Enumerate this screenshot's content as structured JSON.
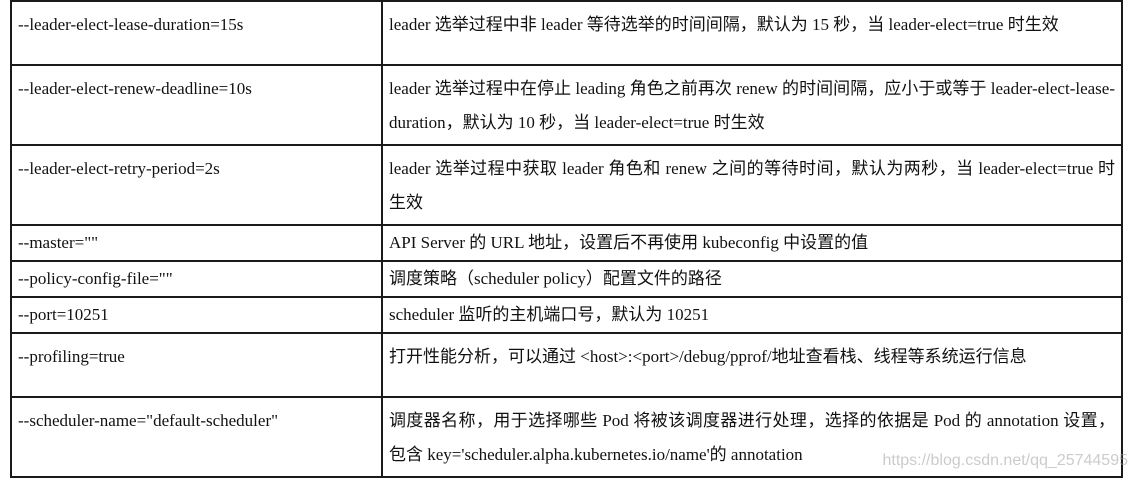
{
  "rows": [
    {
      "param": "--leader-elect-lease-duration=15s",
      "desc": "leader 选举过程中非 leader 等待选举的时间间隔，默认为 15 秒，当 leader-elect=true 时生效"
    },
    {
      "param": "--leader-elect-renew-deadline=10s",
      "desc": "leader 选举过程中在停止 leading 角色之前再次 renew 的时间间隔，应小于或等于 leader-elect-lease-duration，默认为 10 秒，当 leader-elect=true 时生效"
    },
    {
      "param": "--leader-elect-retry-period=2s",
      "desc": "leader 选举过程中获取 leader 角色和 renew 之间的等待时间，默认为两秒，当 leader-elect=true 时生效"
    },
    {
      "param": "--master=\"\"",
      "desc": "API Server 的 URL 地址，设置后不再使用 kubeconfig 中设置的值"
    },
    {
      "param": "--policy-config-file=\"\"",
      "desc": "调度策略（scheduler policy）配置文件的路径"
    },
    {
      "param": "--port=10251",
      "desc": "scheduler 监听的主机端口号，默认为 10251"
    },
    {
      "param": "--profiling=true",
      "desc": "打开性能分析，可以通过 <host>:<port>/debug/pprof/地址查看栈、线程等系统运行信息"
    },
    {
      "param": "--scheduler-name=\"default-scheduler\"",
      "desc": "调度器名称，用于选择哪些 Pod 将被该调度器进行处理，选择的依据是 Pod 的 annotation 设置，包含 key='scheduler.alpha.kubernetes.io/name'的 annotation"
    }
  ],
  "watermark": "https://blog.csdn.net/qq_25744595"
}
